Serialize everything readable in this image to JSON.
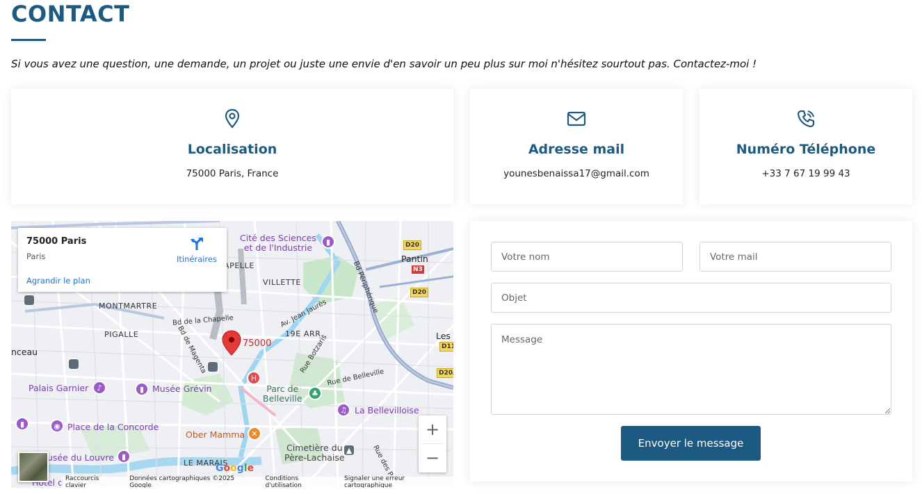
{
  "section": {
    "title": "CONTACT",
    "intro": "Si vous avez une question, une demande, un projet ou juste une envie d'en savoir un peu plus sur moi n'hésitez sourtout pas. Contactez-moi !"
  },
  "cards": [
    {
      "title": "Localisation",
      "value": "75000 Paris, France",
      "icon": "map-pin-icon"
    },
    {
      "title": "Adresse mail",
      "value": "younesbenaissa17@gmail.com",
      "icon": "mail-icon"
    },
    {
      "title": "Numéro Téléphone",
      "value": "+33 7 67 19 99 43",
      "icon": "phone-icon"
    }
  ],
  "map": {
    "info": {
      "title": "75000 Paris",
      "subtitle": "Paris",
      "directions": "Itinéraires",
      "enlarge": "Agrandir le plan"
    },
    "marker_label": "75000",
    "districts": [
      "APELLE",
      "VILLETTE",
      "MONTMARTRE",
      "PIGALLE",
      "19E ARR.",
      "LE MARAIS"
    ],
    "streets": [
      "Bd de la Chapelle",
      "Av. Jean Jaurès",
      "Bd de Magenta",
      "Rue Botzaris",
      "Rue de Belleville",
      "Bd Périphérique",
      "Rue des P"
    ],
    "places": {
      "cite": "Cité des Sciences\net de l'Industrie",
      "pantin": "Pantin",
      "les": "Les",
      "nceau": "nceau",
      "garnier": "Palais Garnier",
      "grevin": "Musée Grévin",
      "parc": "Parc de\nBelleville",
      "bellevilloise": "La Bellevilloise",
      "concorde": "Place de la Concorde",
      "ober": "Ober Mamma",
      "pere": "Cimetière du\nPère-Lachaise",
      "louvre": "usée du Louvre",
      "hotel": "Hôtel d"
    },
    "roads": {
      "d20a": "D20",
      "n3": "N3",
      "d20b": "D20",
      "d11": "D11",
      "d20c": "D20A"
    },
    "google": "Google",
    "attribution": [
      "Raccourcis clavier",
      "Données cartographiques ©2025 Google",
      "Conditions d'utilisation",
      "Signaler une erreur cartographique"
    ],
    "zoom_in": "+",
    "zoom_out": "−"
  },
  "form": {
    "name_placeholder": "Votre nom",
    "mail_placeholder": "Votre mail",
    "subject_placeholder": "Objet",
    "message_placeholder": "Message",
    "submit_label": "Envoyer le message"
  },
  "colors": {
    "brand": "#1d5a82"
  }
}
